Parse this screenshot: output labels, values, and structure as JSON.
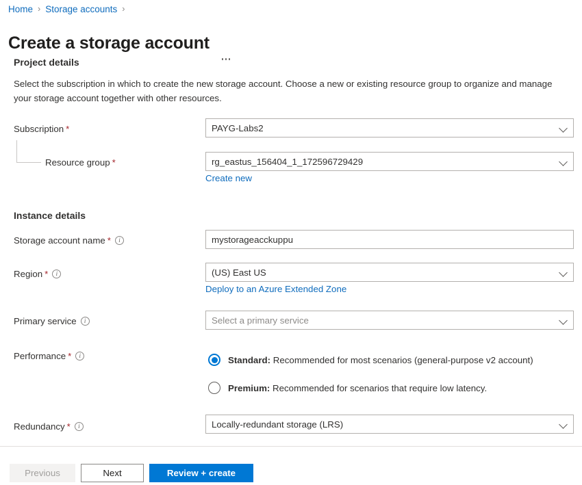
{
  "breadcrumb": {
    "items": [
      {
        "label": "Home"
      },
      {
        "label": "Storage accounts"
      }
    ],
    "separator": "›",
    "trailing_separator": "›"
  },
  "header": {
    "title": "Create a storage account",
    "more_menu_label": "…"
  },
  "project_details": {
    "heading": "Project details",
    "description": "Select the subscription in which to create the new storage account. Choose a new or existing resource group to organize and manage your storage account together with other resources.",
    "subscription": {
      "label": "Subscription",
      "required": "*",
      "value": "PAYG-Labs2"
    },
    "resource_group": {
      "label": "Resource group",
      "required": "*",
      "value": "rg_eastus_156404_1_172596729429",
      "create_new_link": "Create new"
    }
  },
  "instance_details": {
    "heading": "Instance details",
    "storage_account_name": {
      "label": "Storage account name",
      "required": "*",
      "value": "mystorageacckuppu"
    },
    "region": {
      "label": "Region",
      "required": "*",
      "value": "(US) East US",
      "extended_zone_link": "Deploy to an Azure Extended Zone"
    },
    "primary_service": {
      "label": "Primary service",
      "placeholder": "Select a primary service",
      "value": "Select a primary service"
    },
    "performance": {
      "label": "Performance",
      "required": "*",
      "options": [
        {
          "name": "Standard",
          "name_suffix": ":",
          "description": " Recommended for most scenarios (general-purpose v2 account)",
          "selected": true
        },
        {
          "name": "Premium",
          "name_suffix": ":",
          "description": " Recommended for scenarios that require low latency.",
          "selected": false
        }
      ]
    },
    "redundancy": {
      "label": "Redundancy",
      "required": "*",
      "value": "Locally-redundant storage (LRS)"
    }
  },
  "footer": {
    "previous_label": "Previous",
    "next_label": "Next",
    "review_create_label": "Review + create"
  },
  "colors": {
    "accent": "#0078d4",
    "link": "#0f6cbd",
    "required_asterisk": "#a4262c",
    "text": "#323130",
    "border": "#b3b0ad",
    "disabled_bg": "#f3f2f1",
    "disabled_text": "#a19f9d"
  },
  "icons": {
    "info": "i",
    "chevron_down": "chevron-down-icon"
  }
}
